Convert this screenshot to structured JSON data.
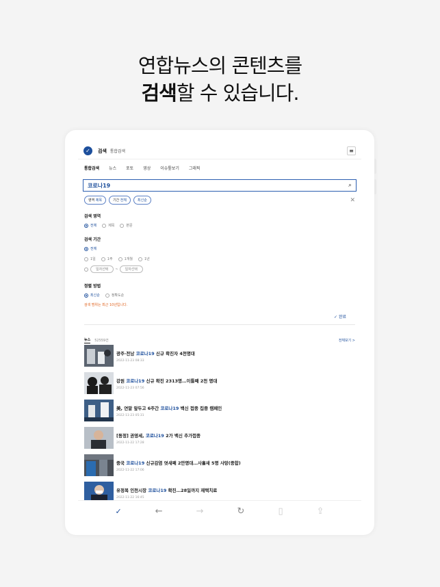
{
  "headline": {
    "line1": "연합뉴스의 콘텐츠를",
    "line2_bold": "검색",
    "line2_rest": "할 수 있습니다."
  },
  "app": {
    "logo_text": "✓",
    "title": "검색",
    "subtitle": "통합검색",
    "menu_icon": "hamburger-icon"
  },
  "tabs": [
    "통합검색",
    "뉴스",
    "포토",
    "영상",
    "이슈톺보기",
    "그래픽"
  ],
  "search": {
    "value": "코로나19"
  },
  "chips": [
    {
      "label": "영역",
      "value": "제목"
    },
    {
      "label": "기간",
      "value": "전체"
    },
    {
      "label": "",
      "value": "최신순"
    }
  ],
  "filters": {
    "area": {
      "title": "검색 영역",
      "options": [
        "전체",
        "제목",
        "본문"
      ],
      "selected": 0
    },
    "period": {
      "title": "검색 기간",
      "all": "전체",
      "options": [
        "1일",
        "1주",
        "1개월",
        "1년"
      ],
      "date_from": "일자선택",
      "date_sep": "~",
      "date_to": "일자선택"
    },
    "sort": {
      "title": "정렬 방법",
      "options": [
        "최신순",
        "정확도순"
      ],
      "selected": 0
    },
    "notice": "검색 범위는 최근 10년입니다.",
    "done": "✓ 완료"
  },
  "news": {
    "title": "뉴스",
    "count": "52559건",
    "see_all": "전체보기 >",
    "items": [
      {
        "pre": "광주·전남 ",
        "kw": "코로나19",
        "post": " 신규 확진자 4천명대",
        "date": "2022-11-23 08:33"
      },
      {
        "pre": "강원 ",
        "kw": "코로나19",
        "post": " 신규 확진 2313명…이틀째 2천 명대",
        "date": "2022-11-23 07:56"
      },
      {
        "pre": "美, 연말 앞두고 6주간 ",
        "kw": "코로나19",
        "post": " 백신 접종 집중 캠페인",
        "date": "2022-11-23 05:31"
      },
      {
        "pre": "[동정] 권영세, ",
        "kw": "코로나19",
        "post": " 2가 백신 추가접종",
        "date": "2022-11-22 17:28"
      },
      {
        "pre": "중국 ",
        "kw": "코로나19",
        "post": " 신규감염 엿새째 2만명대…사흘새 5명 사망(종합)",
        "date": "2022-11-22 17:06"
      },
      {
        "pre": "유정복 인천시장 ",
        "kw": "코로나19",
        "post": " 확진…28일까지 재택치료",
        "date": "2022-11-22 16:45"
      }
    ]
  },
  "bottom_nav": [
    {
      "icon": "home-logo-icon",
      "glyph": "✓"
    },
    {
      "icon": "back-arrow-icon",
      "glyph": "←"
    },
    {
      "icon": "forward-arrow-icon",
      "glyph": "→"
    },
    {
      "icon": "refresh-icon",
      "glyph": "↻"
    },
    {
      "icon": "bookmark-icon",
      "glyph": "▯"
    },
    {
      "icon": "share-icon",
      "glyph": "⇪"
    }
  ],
  "colors": {
    "accent": "#1d4f9c",
    "notice": "#e0631e"
  }
}
